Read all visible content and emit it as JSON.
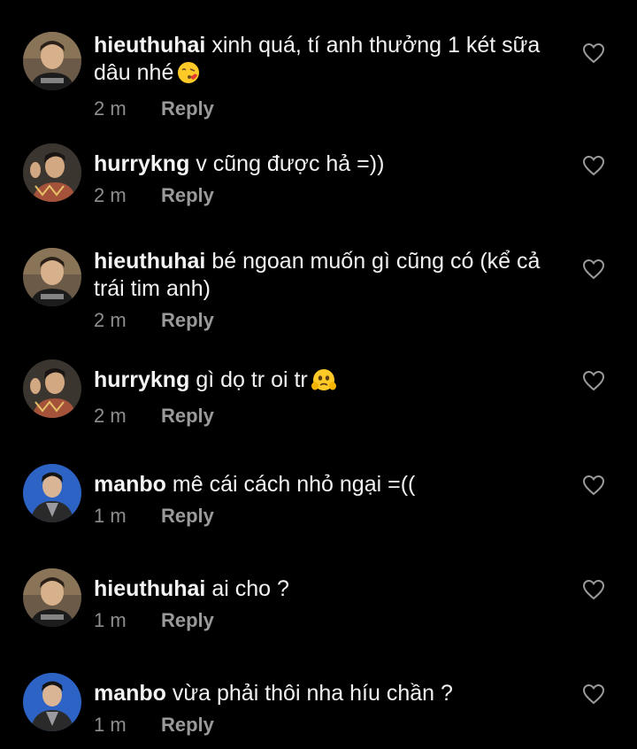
{
  "comments": [
    {
      "username": "hieuthuhai",
      "text": "xinh quá, tí anh thưởng 1 két sữa dâu nhé",
      "emoji": "kissing-face-emoji",
      "time": "2 m",
      "reply": "Reply",
      "avatar": "hieuthuhai-avatar"
    },
    {
      "username": "hurrykng",
      "text": "v cũng được hả =))",
      "time": "2 m",
      "reply": "Reply",
      "avatar": "hurrykng-avatar"
    },
    {
      "username": "hieuthuhai",
      "text": "bé ngoan muốn gì cũng có (kể cả trái tim anh)",
      "time": "2 m",
      "reply": "Reply",
      "avatar": "hieuthuhai-avatar"
    },
    {
      "username": "hurrykng",
      "text": "gì dọ tr oi tr",
      "emoji": "face-holding-back-tears-emoji",
      "time": "2 m",
      "reply": "Reply",
      "avatar": "hurrykng-avatar"
    },
    {
      "username": "manbo",
      "text": "mê cái cách nhỏ ngại =((",
      "time": "1 m",
      "reply": "Reply",
      "avatar": "manbo-avatar"
    },
    {
      "username": "hieuthuhai",
      "text": "ai cho ?",
      "time": "1 m",
      "reply": "Reply",
      "avatar": "hieuthuhai-avatar"
    },
    {
      "username": "manbo",
      "text": "vừa phải thôi nha híu chần ?",
      "time": "1 m",
      "reply": "Reply",
      "avatar": "manbo-avatar"
    }
  ],
  "icons": {
    "like": "heart-outline-icon"
  },
  "colors": {
    "background": "#000000",
    "text": "#f2f2f2",
    "meta": "#8e8e8e"
  }
}
